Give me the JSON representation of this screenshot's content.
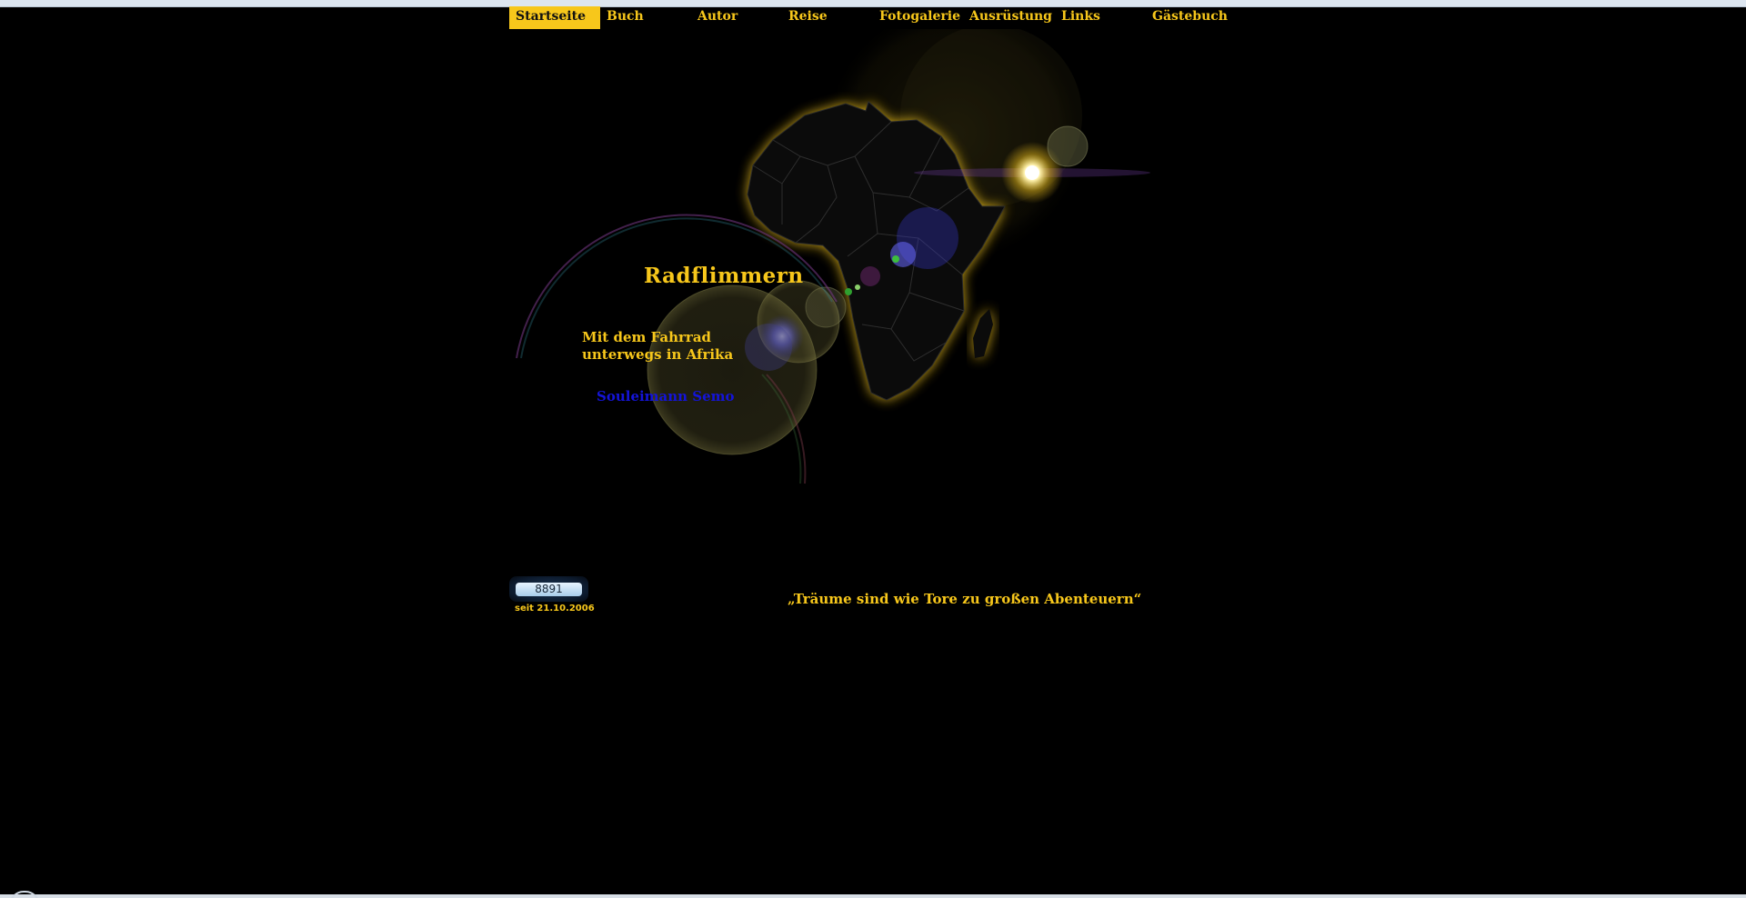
{
  "nav": {
    "items": [
      {
        "label": "Startseite",
        "active": true
      },
      {
        "label": "Buch",
        "active": false
      },
      {
        "label": "Autor",
        "active": false
      },
      {
        "label": "Reise",
        "active": false
      },
      {
        "label": "Fotogalerie",
        "active": false
      },
      {
        "label": "Ausrüstung",
        "active": false
      },
      {
        "label": "Links",
        "active": false
      },
      {
        "label": "Gästebuch",
        "active": false
      }
    ]
  },
  "hero": {
    "title": "Radflimmern",
    "subtitle_line1": "Mit dem Fahrrad",
    "subtitle_line2": "unterwegs in Afrika",
    "author": "Souleimann Semo"
  },
  "counter": {
    "value": "8891",
    "since": "seit 21.10.2006"
  },
  "quote": "„Träume sind wie Tore zu großen Abenteuern“",
  "colors": {
    "accent": "#f7c71b",
    "background": "#000000",
    "author": "#1414d8"
  }
}
